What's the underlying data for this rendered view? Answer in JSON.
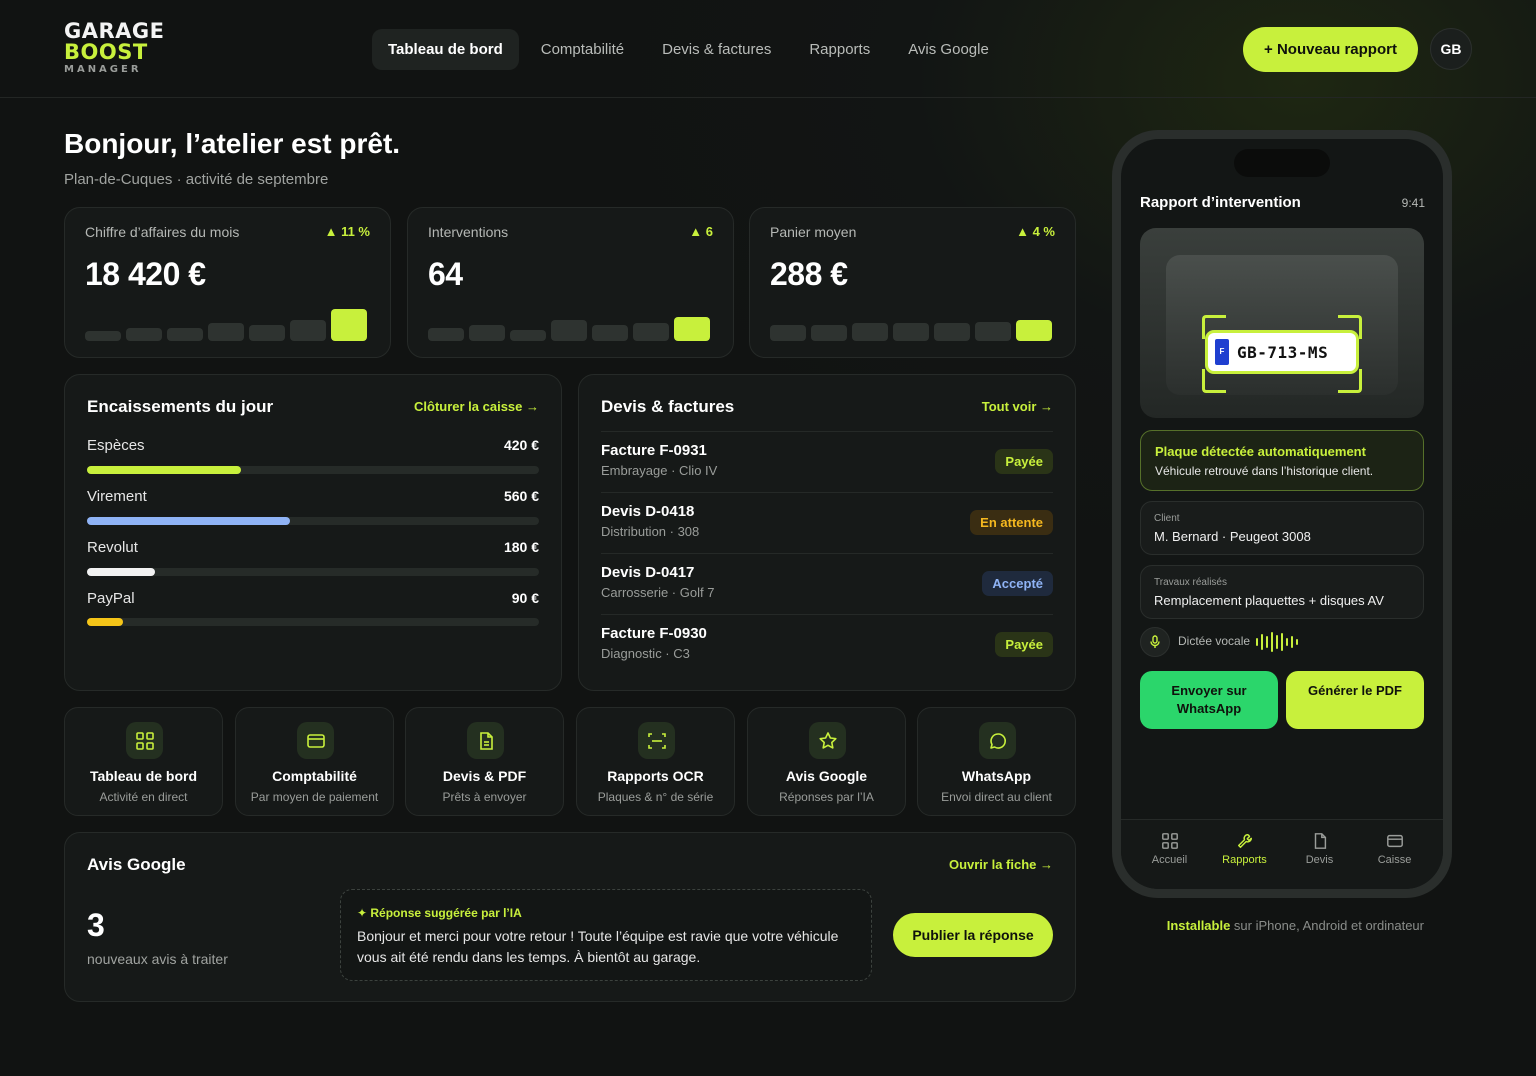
{
  "brand": {
    "line1": "GARAGE",
    "line2": "BOOST",
    "line3": "MANAGER"
  },
  "nav": [
    {
      "label": "Tableau de bord",
      "active": true
    },
    {
      "label": "Comptabilité",
      "active": false
    },
    {
      "label": "Devis & factures",
      "active": false
    },
    {
      "label": "Rapports",
      "active": false
    },
    {
      "label": "Avis Google",
      "active": false
    }
  ],
  "header": {
    "new_report_label": "+ Nouveau rapport",
    "avatar_initials": "GB"
  },
  "greeting": {
    "title": "Bonjour, l’atelier est prêt.",
    "subtitle": "Plan-de-Cuques · activité de septembre"
  },
  "kpis": [
    {
      "label": "Chiffre d’affaires du mois",
      "delta": "▲ 11 %",
      "value": "18 420 €",
      "spark": [
        0.3,
        0.4,
        0.4,
        0.55,
        0.5,
        0.65,
        1.0
      ]
    },
    {
      "label": "Interventions",
      "delta": "▲ 6",
      "value": "64",
      "spark": [
        0.4,
        0.5,
        0.35,
        0.65,
        0.5,
        0.55,
        0.75
      ]
    },
    {
      "label": "Panier moyen",
      "delta": "▲ 4 %",
      "value": "288 €",
      "spark": [
        0.5,
        0.5,
        0.55,
        0.55,
        0.55,
        0.6,
        0.65
      ]
    }
  ],
  "payments": {
    "title": "Encaissements du jour",
    "link": "Clôturer la caisse →",
    "rows": [
      {
        "label": "Espèces",
        "amount": "420 €",
        "fill": 0.34,
        "color": "#c8f03c"
      },
      {
        "label": "Virement",
        "amount": "560 €",
        "fill": 0.45,
        "color": "#8fb3f5"
      },
      {
        "label": "Revolut",
        "amount": "180 €",
        "fill": 0.15,
        "color": "#f2f2f2"
      },
      {
        "label": "PayPal",
        "amount": "90 €",
        "fill": 0.08,
        "color": "#f5c518"
      }
    ]
  },
  "docs": {
    "title": "Devis & factures",
    "link": "Tout voir →",
    "rows": [
      {
        "title": "Facture F-0931",
        "sub": "Embrayage · Clio IV",
        "badge": "Payée",
        "status": "paid"
      },
      {
        "title": "Devis D-0418",
        "sub": "Distribution · 308",
        "badge": "En attente",
        "status": "pending"
      },
      {
        "title": "Devis D-0417",
        "sub": "Carrosserie · Golf 7",
        "badge": "Accepté",
        "status": "accepted"
      },
      {
        "title": "Facture F-0930",
        "sub": "Diagnostic · C3",
        "badge": "Payée",
        "status": "paid"
      }
    ]
  },
  "tiles": [
    {
      "title": "Tableau de bord",
      "sub": "Activité en direct",
      "icon": "grid-icon"
    },
    {
      "title": "Comptabilité",
      "sub": "Par moyen de paiement",
      "icon": "card-icon"
    },
    {
      "title": "Devis & PDF",
      "sub": "Prêts à envoyer",
      "icon": "document-icon"
    },
    {
      "title": "Rapports OCR",
      "sub": "Plaques & n° de série",
      "icon": "scan-icon"
    },
    {
      "title": "Avis Google",
      "sub": "Réponses par l’IA",
      "icon": "star-icon"
    },
    {
      "title": "WhatsApp",
      "sub": "Envoi direct au client",
      "icon": "chat-icon"
    }
  ],
  "google": {
    "title": "Avis Google",
    "link": "Ouvrir la fiche →",
    "count": "3",
    "count_label": "nouveaux avis à traiter",
    "ai_head": "✦ Réponse suggérée par l’IA",
    "ai_text": "Bonjour et merci pour votre retour ! Toute l’équipe est ravie que votre véhicule vous ait été rendu dans les temps. À bientôt au garage.",
    "publish": "Publier la réponse"
  },
  "phone": {
    "title": "Rapport d’intervention",
    "time": "9:41",
    "plate_country": "F",
    "plate": "GB-713-MS",
    "detect_title": "Plaque détectée automatiquement",
    "detect_sub": "Véhicule retrouvé dans l’historique client.",
    "client_label": "Client",
    "client_value": "M. Bernard · Peugeot 3008",
    "work_label": "Travaux réalisés",
    "work_value": "Remplacement plaquettes + disques AV",
    "voice_label": "Dictée vocale",
    "btn_whatsapp": "Envoyer sur WhatsApp",
    "btn_pdf": "Générer le PDF",
    "tabs": [
      {
        "label": "Accueil",
        "icon": "grid-icon",
        "active": false
      },
      {
        "label": "Rapports",
        "icon": "wrench-icon",
        "active": true
      },
      {
        "label": "Devis",
        "icon": "document-icon",
        "active": false
      },
      {
        "label": "Caisse",
        "icon": "card-icon",
        "active": false
      }
    ]
  },
  "install": {
    "bold": "Installable",
    "rest": " sur iPhone, Android et ordinateur"
  },
  "colors": {
    "accent": "#c8f03c",
    "whatsapp": "#2bd66b",
    "bg": "#111312"
  }
}
